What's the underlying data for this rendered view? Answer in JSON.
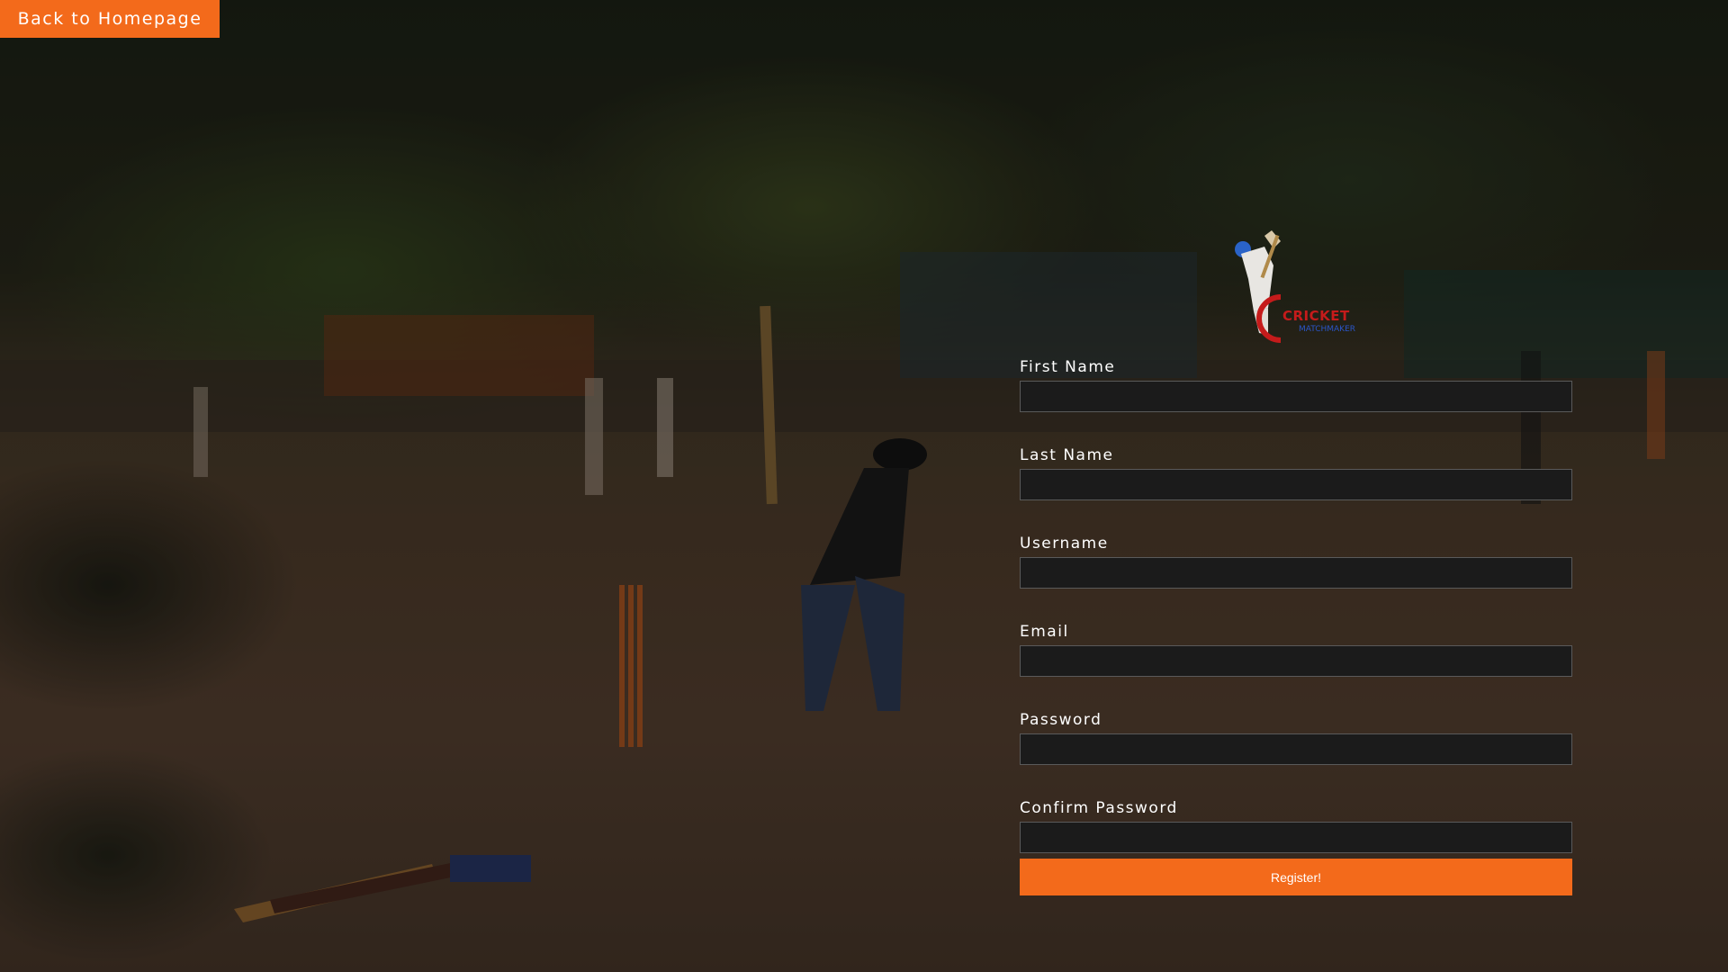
{
  "nav": {
    "back_label": "Back to Homepage"
  },
  "logo": {
    "brand": "CRICKET",
    "tagline": "MATCHMAKER"
  },
  "form": {
    "fields": [
      {
        "label": "First Name",
        "value": ""
      },
      {
        "label": "Last Name",
        "value": ""
      },
      {
        "label": "Username",
        "value": ""
      },
      {
        "label": "Email",
        "value": ""
      },
      {
        "label": "Password",
        "value": ""
      },
      {
        "label": "Confirm Password",
        "value": ""
      }
    ],
    "submit_label": "Register!"
  },
  "colors": {
    "accent": "#f36a1b",
    "input_bg": "#1b1b1b",
    "logo_red": "#c51b1b",
    "logo_blue": "#2a55c8"
  }
}
